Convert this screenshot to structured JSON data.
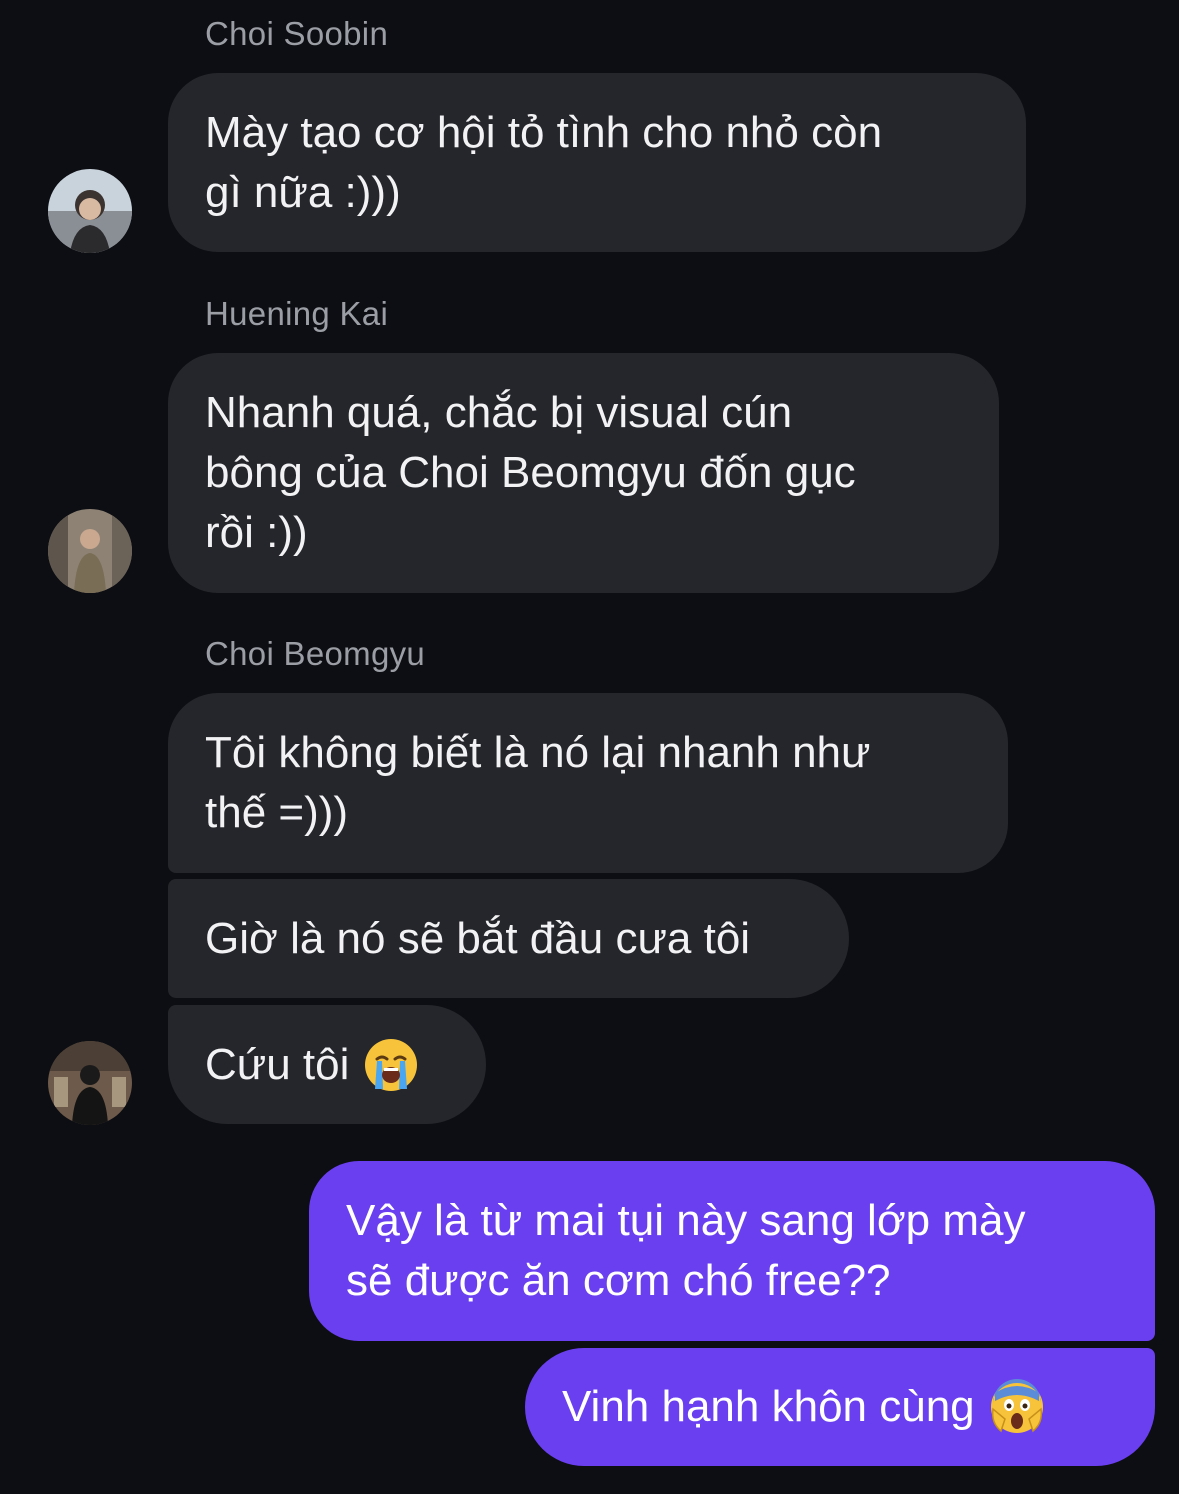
{
  "conversation": {
    "groups": [
      {
        "sender": "Choi Soobin",
        "avatar_icon": "user-avatar-icon",
        "messages": [
          {
            "text": "Mày tạo cơ hội tỏ tình cho nhỏ còn\ngì nữa :)))"
          }
        ]
      },
      {
        "sender": "Huening Kai",
        "avatar_icon": "user-avatar-icon",
        "messages": [
          {
            "text": "Nhanh quá, chắc bị visual cún\nbông của Choi Beomgyu đốn gục\nrồi :))"
          }
        ]
      },
      {
        "sender": "Choi Beomgyu",
        "avatar_icon": "user-avatar-icon",
        "messages": [
          {
            "text": "Tôi không biết là nó lại nhanh như\nthế =)))"
          },
          {
            "text": "Giờ là nó sẽ bắt đầu cưa tôi"
          },
          {
            "text": "Cứu tôi",
            "emoji": "loudly-crying-face-emoji"
          }
        ]
      }
    ],
    "outgoing": [
      {
        "text": "Vậy là từ mai tụi này sang lớp mày\nsẽ được ăn cơm chó free??"
      },
      {
        "text": "Vinh hạnh khôn cùng",
        "emoji": "screaming-in-fear-face-emoji"
      }
    ]
  },
  "colors": {
    "background": "#0d0e13",
    "incoming_bubble": "#25262b",
    "outgoing_bubble": "#6a3ff0",
    "sender_name": "#9c9ea6",
    "text": "#f2f2f4"
  }
}
